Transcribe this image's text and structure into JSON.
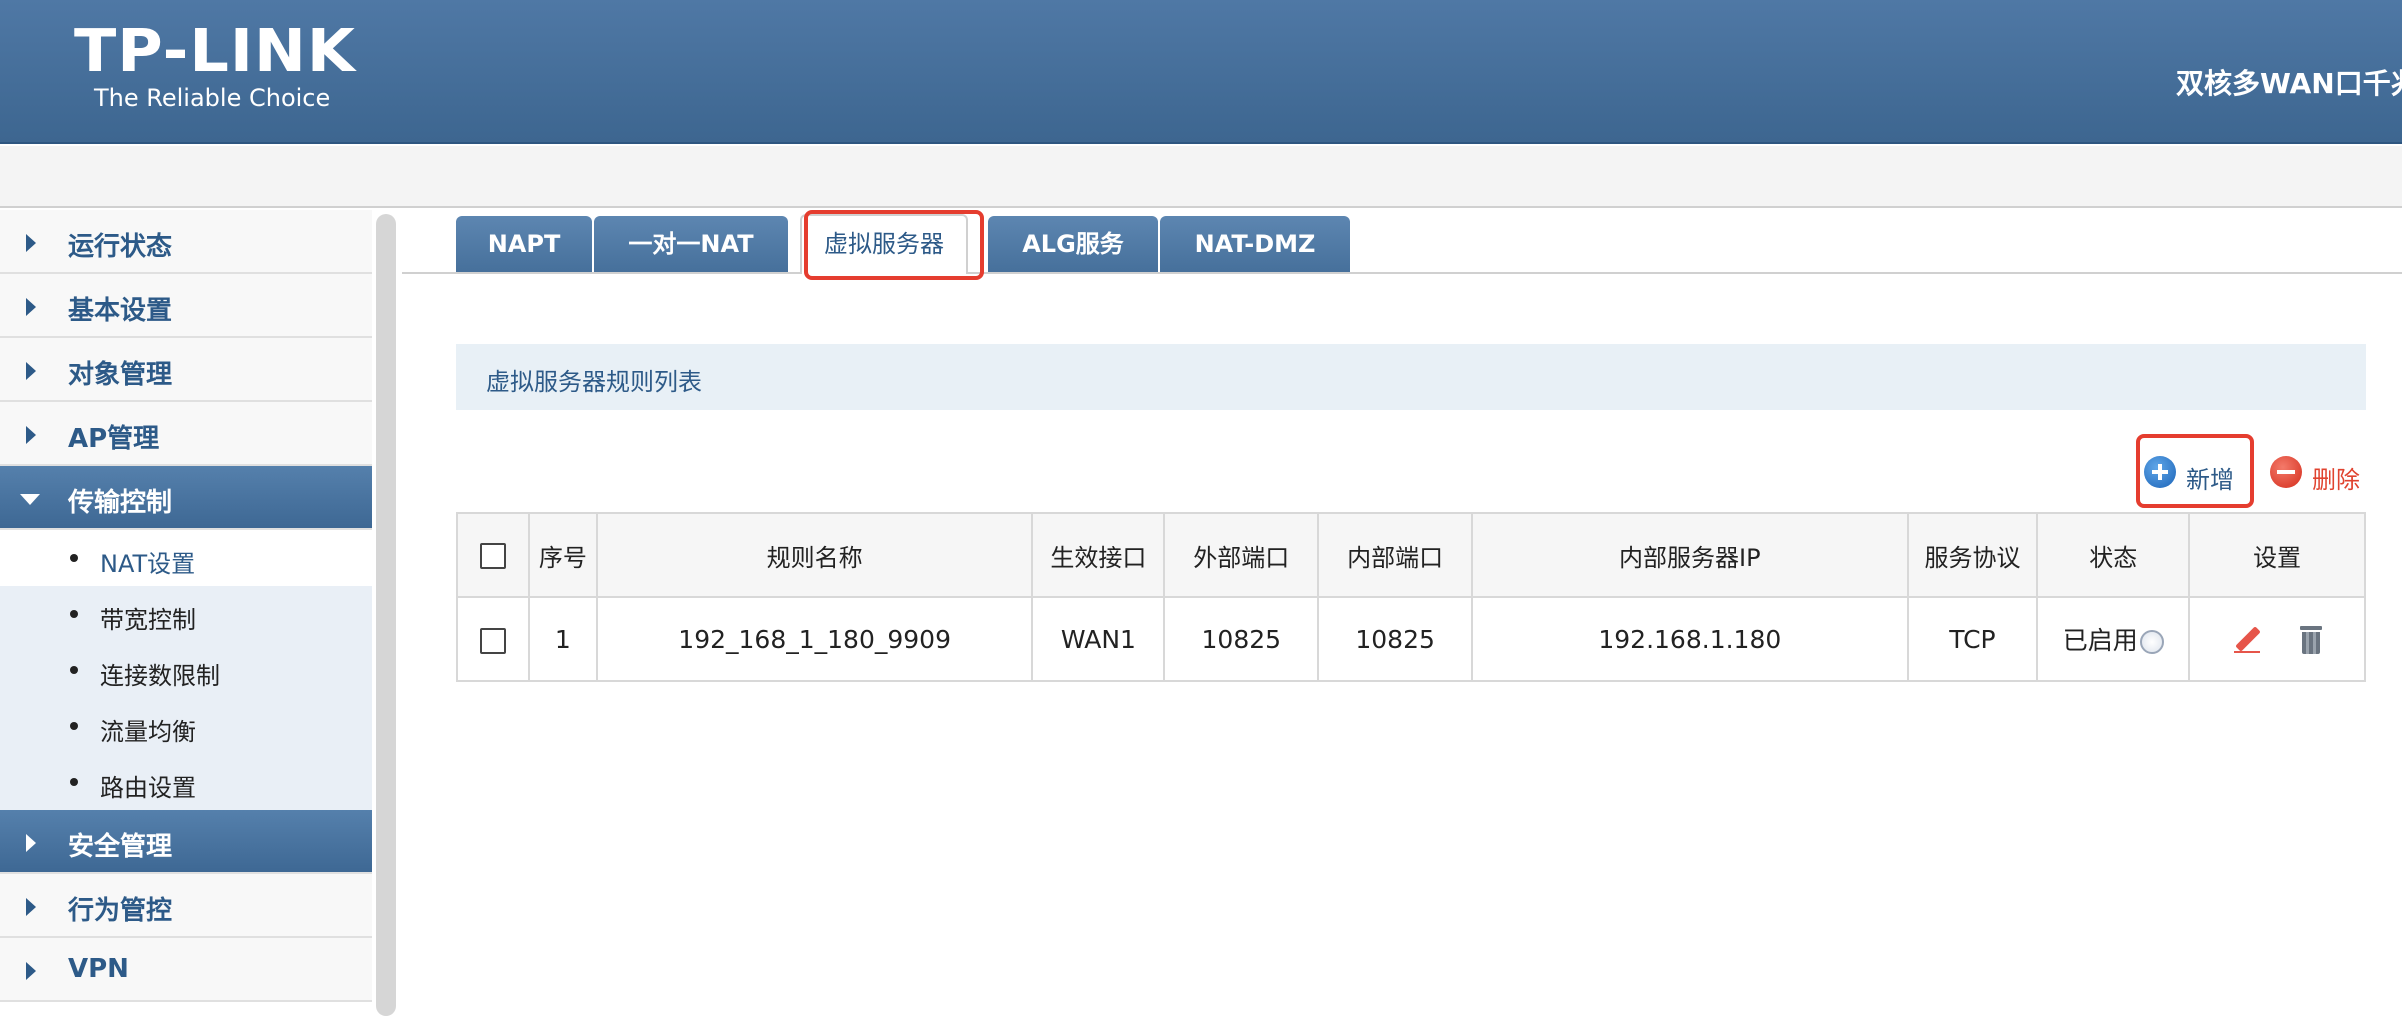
{
  "header": {
    "logo_main": "TP-LINK",
    "logo_sub": "The Reliable Choice",
    "title": "双核多WAN口千兆"
  },
  "sidebar": {
    "items": [
      {
        "label": "运行状态"
      },
      {
        "label": "基本设置"
      },
      {
        "label": "对象管理"
      },
      {
        "label": "AP管理"
      },
      {
        "label": "传输控制",
        "expanded": true,
        "children": [
          {
            "label": "NAT设置",
            "selected": true
          },
          {
            "label": "带宽控制"
          },
          {
            "label": "连接数限制"
          },
          {
            "label": "流量均衡"
          },
          {
            "label": "路由设置"
          }
        ]
      },
      {
        "label": "安全管理"
      },
      {
        "label": "行为管控"
      },
      {
        "label": "VPN"
      }
    ]
  },
  "tabs": [
    {
      "label": "NAPT"
    },
    {
      "label": "一对一NAT"
    },
    {
      "label": "虚拟服务器",
      "active": true
    },
    {
      "label": "ALG服务"
    },
    {
      "label": "NAT-DMZ"
    }
  ],
  "panel": {
    "title": "虚拟服务器规则列表",
    "add_label": "新增",
    "delete_label": "删除"
  },
  "table": {
    "headers": [
      "序号",
      "规则名称",
      "生效接口",
      "外部端口",
      "内部端口",
      "内部服务器IP",
      "服务协议",
      "状态",
      "设置"
    ],
    "rows": [
      {
        "index": "1",
        "name": "192_168_1_180_9909",
        "interface": "WAN1",
        "ext_port": "10825",
        "int_port": "10825",
        "server_ip": "192.168.1.180",
        "protocol": "TCP",
        "status": "已启用"
      }
    ]
  },
  "colors": {
    "header_blue": "#4a73a0",
    "nav_text": "#2d5a88",
    "highlight_red": "#e53d2f"
  }
}
